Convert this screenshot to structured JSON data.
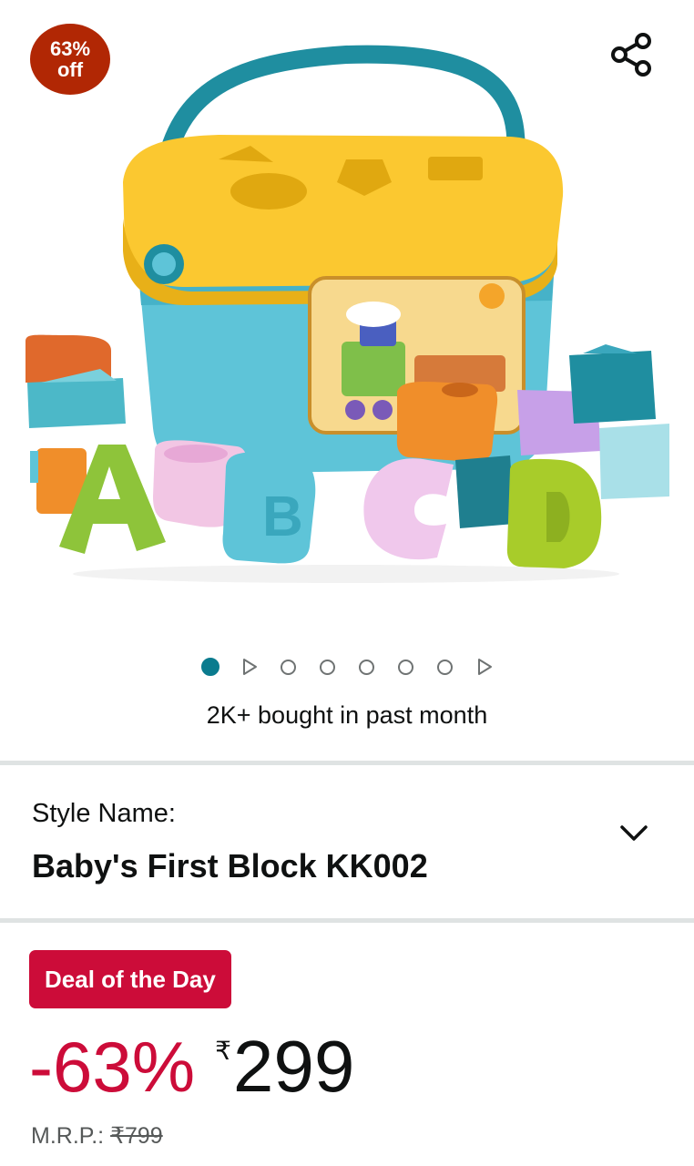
{
  "badge": {
    "line1": "63%",
    "line2": "off"
  },
  "carousel": {
    "slides": [
      "image",
      "video",
      "image",
      "image",
      "image",
      "image",
      "image",
      "video"
    ],
    "active_index": 0
  },
  "bought_text": "2K+ bought in past month",
  "style": {
    "label": "Style Name:",
    "value": "Baby's First Block KK002"
  },
  "deal": {
    "label": "Deal of the Day"
  },
  "price": {
    "discount": "-63%",
    "currency": "₹",
    "amount": "299"
  },
  "mrp": {
    "label": "M.R.P.:",
    "value": "₹799"
  },
  "colors": {
    "badge": "#b12704",
    "deal": "#cc0c39",
    "dot_active": "#0a7b8e"
  },
  "icons": {
    "share": "share-icon",
    "dropdown": "chevron-down-icon"
  }
}
